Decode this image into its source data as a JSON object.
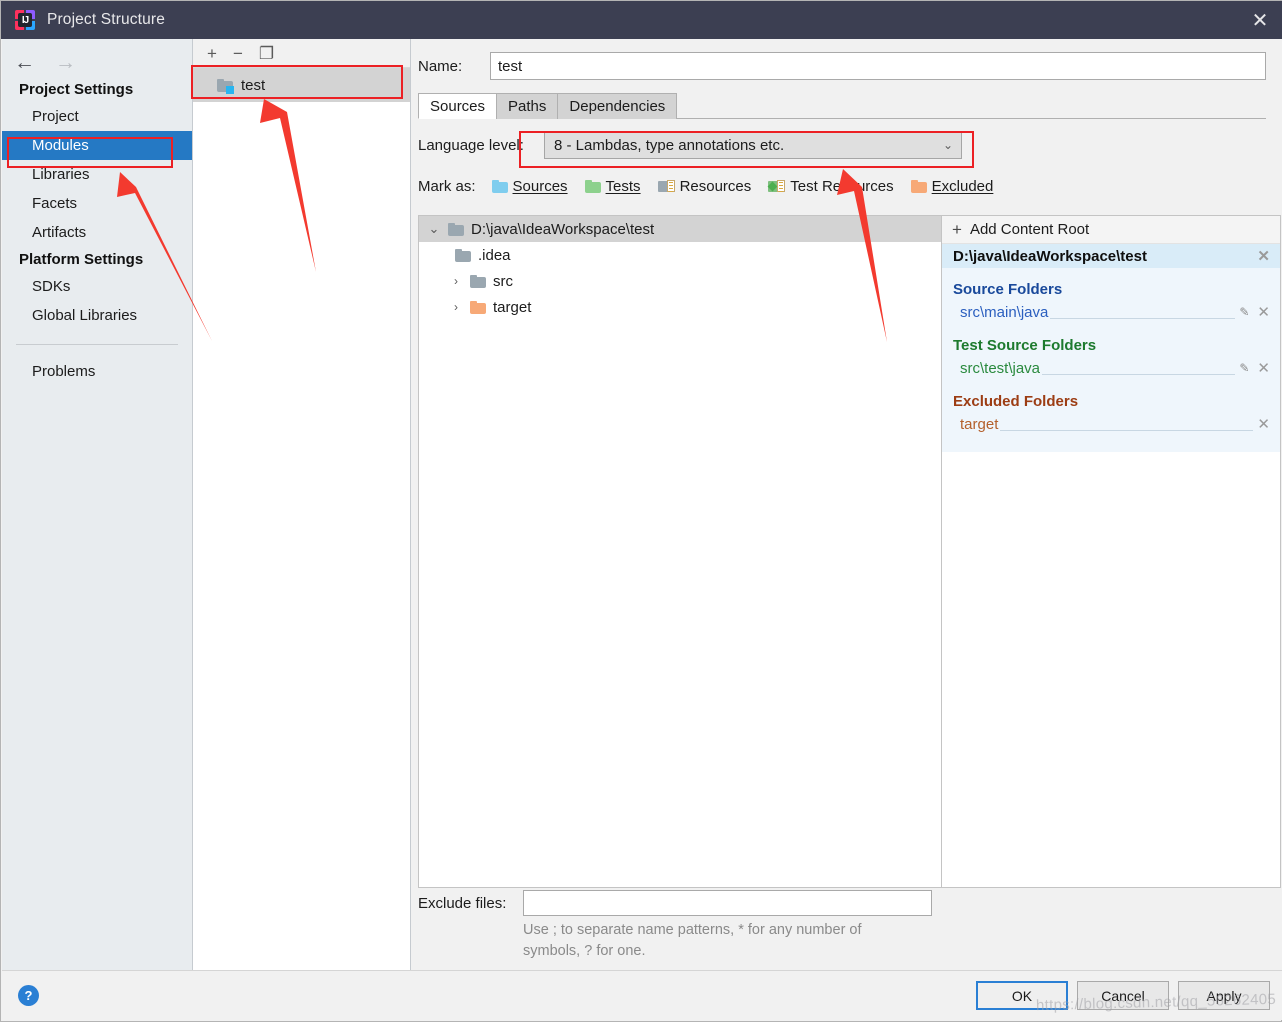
{
  "window": {
    "title": "Project Structure",
    "logo_text": "IJ",
    "close_label": "✕"
  },
  "nav": {
    "back_icon": "←",
    "forward_icon": "→"
  },
  "sidebar": {
    "groups": [
      {
        "label": "Project Settings"
      },
      {
        "label": "Platform Settings"
      }
    ],
    "project_settings_items": [
      {
        "label": "Project",
        "selected": false
      },
      {
        "label": "Modules",
        "selected": true
      },
      {
        "label": "Libraries",
        "selected": false
      },
      {
        "label": "Facets",
        "selected": false
      },
      {
        "label": "Artifacts",
        "selected": false
      }
    ],
    "platform_settings_items": [
      {
        "label": "SDKs",
        "selected": false
      },
      {
        "label": "Global Libraries",
        "selected": false
      }
    ],
    "problems_label": "Problems"
  },
  "modules_panel": {
    "toolbar": {
      "add_icon": "+",
      "remove_icon": "−",
      "copy_icon": "❐"
    },
    "items": [
      {
        "label": "test",
        "selected": true
      }
    ]
  },
  "module_editor": {
    "name_label": "Name:",
    "name_value": "test",
    "name_placeholder": "",
    "tabs": [
      {
        "label": "Sources",
        "active": true
      },
      {
        "label": "Paths",
        "active": false
      },
      {
        "label": "Dependencies",
        "active": false
      }
    ],
    "language_level": {
      "label": "Language level:",
      "value": "8 - Lambdas, type annotations etc.",
      "chevron": "⌄"
    },
    "mark_as": {
      "label": "Mark as:",
      "options": [
        {
          "label": "Sources",
          "icon": "folder-blue-icon"
        },
        {
          "label": "Tests",
          "icon": "folder-green-icon"
        },
        {
          "label": "Resources",
          "icon": "resources-icon"
        },
        {
          "label": "Test Resources",
          "icon": "test-resources-icon"
        },
        {
          "label": "Excluded",
          "icon": "folder-orange-icon"
        }
      ]
    },
    "tree": [
      {
        "label": "D:\\java\\IdeaWorkspace\\test",
        "indent": 0,
        "twisty": "⌄",
        "icon": "folder-gray-icon",
        "selected": true
      },
      {
        "label": ".idea",
        "indent": 1,
        "twisty": "",
        "icon": "folder-gray-icon",
        "selected": false
      },
      {
        "label": "src",
        "indent": 1,
        "twisty": "›",
        "icon": "folder-gray-icon",
        "selected": false
      },
      {
        "label": "target",
        "indent": 1,
        "twisty": "›",
        "icon": "folder-orange-icon",
        "selected": false
      }
    ],
    "content_roots": {
      "add_label": "Add Content Root",
      "add_icon": "+",
      "root_path": "D:\\java\\IdeaWorkspace\\test",
      "remove_icon": "✕",
      "groups": [
        {
          "title": "Source Folders",
          "kind": "source",
          "folders": [
            {
              "path": "src\\main\\java",
              "editable": true
            }
          ]
        },
        {
          "title": "Test Source Folders",
          "kind": "test",
          "folders": [
            {
              "path": "src\\test\\java",
              "editable": true
            }
          ]
        },
        {
          "title": "Excluded Folders",
          "kind": "excluded",
          "folders": [
            {
              "path": "target",
              "editable": false
            }
          ]
        }
      ],
      "pencil_icon": "✎"
    },
    "exclude_files": {
      "label": "Exclude files:",
      "value": "",
      "placeholder": "",
      "hint": "Use ; to separate name patterns, * for any number of symbols, ? for one."
    }
  },
  "footer": {
    "help_icon": "?",
    "buttons": [
      {
        "label": "OK",
        "primary": true
      },
      {
        "label": "Cancel",
        "primary": false
      },
      {
        "label": "Apply",
        "primary": false
      }
    ]
  },
  "watermark": {
    "text": "https://blog.csdn.net/qq_56262405"
  },
  "annotation": {
    "color": "#ec2024"
  }
}
